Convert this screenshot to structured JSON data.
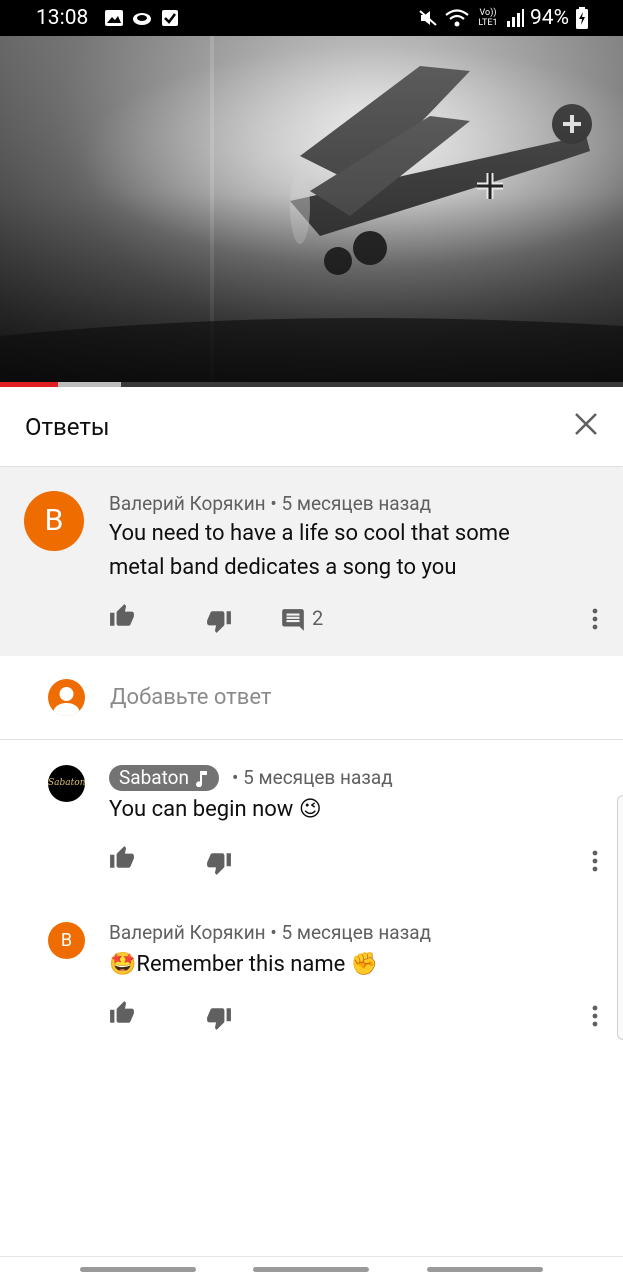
{
  "status_bar": {
    "time": "13:08",
    "left_icons": [
      "image-icon",
      "cloud-icon",
      "check-box-icon"
    ],
    "right_icons": [
      "mute-icon",
      "wifi-icon",
      "volte-icon",
      "signal-icon"
    ],
    "volte_label": "Vo)) LTE1",
    "battery": "94%"
  },
  "video": {
    "progress_fraction": 0.093,
    "buffered_fraction": 0.194,
    "accent_color": "#e02020"
  },
  "header": {
    "title": "Ответы",
    "close_icon": "close-icon"
  },
  "main_comment": {
    "avatar_letter": "B",
    "author": "Валерий Корякин",
    "separator": "•",
    "time": "5 месяцев назад",
    "text_line1": "You need to have a life so cool that some",
    "text_line2": "metal band dedicates a song to you",
    "reply_count": "2"
  },
  "add_reply": {
    "placeholder": "Добавьте ответ"
  },
  "replies": [
    {
      "author": "Sabaton",
      "avatar_text": "Sabaton",
      "verified_icon": "music-note-icon",
      "separator": "•",
      "time": "5 месяцев назад",
      "text": "You can begin now 😉"
    },
    {
      "author": "Валерий Корякин",
      "avatar_letter": "B",
      "separator": "•",
      "time": "5 месяцев назад",
      "text": "🤩Remember this name ✊"
    }
  ]
}
